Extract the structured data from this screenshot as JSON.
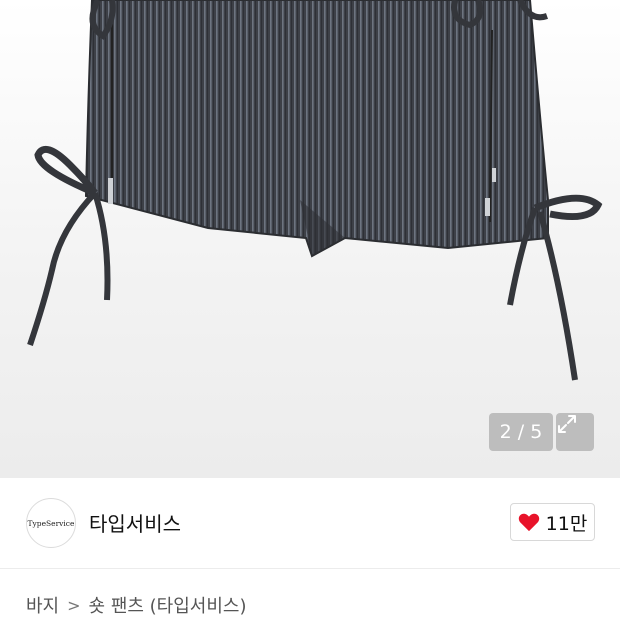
{
  "gallery": {
    "counter": "2 / 5",
    "expand_icon": "expand-arrows-icon"
  },
  "brand": {
    "logo_text": "TypeService",
    "name": "타입서비스",
    "like_icon": "heart-icon",
    "like_color": "#e8132a",
    "like_count": "11만"
  },
  "breadcrumb": {
    "level1": "바지",
    "separator": ">",
    "level2": "숏 팬츠 (타입서비스)"
  }
}
